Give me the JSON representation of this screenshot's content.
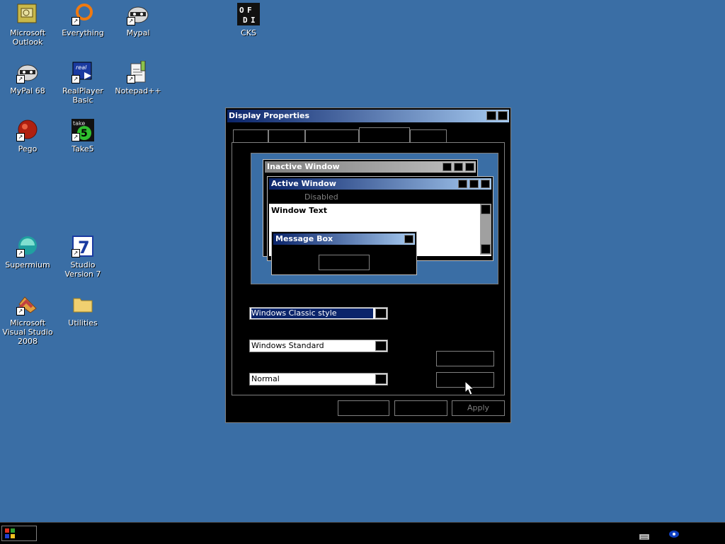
{
  "desktop": {
    "icons": [
      {
        "label": "Microsoft Outlook",
        "icon": "outlook-icon"
      },
      {
        "label": "Everything",
        "icon": "everything-icon"
      },
      {
        "label": "Mypal",
        "icon": "mypal-icon"
      },
      {
        "label": "CKS",
        "icon": "cks-icon"
      },
      {
        "label": "MyPal 68",
        "icon": "mypal68-icon"
      },
      {
        "label": "RealPlayer Basic",
        "icon": "realplayer-icon"
      },
      {
        "label": "Notepad++",
        "icon": "notepadpp-icon"
      },
      {
        "label": "Pego",
        "icon": "pego-icon"
      },
      {
        "label": "Take5",
        "icon": "take5-icon"
      },
      {
        "label": "Supermium",
        "icon": "supermium-icon"
      },
      {
        "label": "Studio Version 7",
        "icon": "studio7-icon"
      },
      {
        "label": "Microsoft Visual Studio 2008",
        "icon": "visualstudio-icon"
      },
      {
        "label": "Utilities",
        "icon": "folder-icon"
      }
    ]
  },
  "window": {
    "title": "Display Properties",
    "preview": {
      "inactive_title": "Inactive Window",
      "active_title": "Active Window",
      "menu_disabled": "Disabled",
      "window_text": "Window Text",
      "message_box_title": "Message Box"
    },
    "windows_buttons_value": "Windows Classic style",
    "color_scheme_value": "Windows Standard",
    "font_size_value": "Normal",
    "apply_label": "Apply"
  },
  "colors": {
    "desktop_bg": "#3a6ea5",
    "title_active_start": "#0a246a",
    "title_active_end": "#a6caf0",
    "window_bg": "#000000"
  }
}
